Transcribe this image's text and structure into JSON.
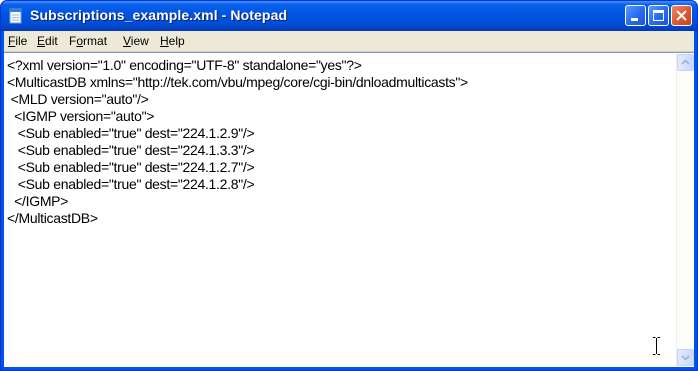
{
  "window": {
    "title": "Subscriptions_example.xml - Notepad",
    "controls": {
      "minimize": "minimize-icon",
      "maximize": "maximize-icon",
      "close": "close-icon"
    }
  },
  "menu": {
    "items": [
      {
        "label": "File",
        "accel": "F",
        "rest": "ile"
      },
      {
        "label": "Edit",
        "accel": "E",
        "rest": "dit"
      },
      {
        "label": "Format",
        "accel": "o",
        "pre": "F",
        "rest": "rmat"
      },
      {
        "label": "View",
        "accel": "V",
        "rest": "iew"
      },
      {
        "label": "Help",
        "accel": "H",
        "rest": "elp"
      }
    ]
  },
  "document": {
    "lines": [
      "<?xml version=\"1.0\" encoding=\"UTF-8\" standalone=\"yes\"?>",
      "<MulticastDB xmlns=\"http://tek.com/vbu/mpeg/core/cgi-bin/dnloadmulticasts\">",
      " <MLD version=\"auto\"/>",
      "  <IGMP version=\"auto\">",
      "   <Sub enabled=\"true\" dest=\"224.1.2.9\"/>",
      "   <Sub enabled=\"true\" dest=\"224.1.3.3\"/>",
      "   <Sub enabled=\"true\" dest=\"224.1.2.7\"/>",
      "   <Sub enabled=\"true\" dest=\"224.1.2.8\"/>",
      "  </IGMP>",
      "</MulticastDB>"
    ]
  },
  "colors": {
    "titlebar": "#0055e5",
    "menubar": "#ece9d8",
    "close_button": "#e05a35"
  }
}
